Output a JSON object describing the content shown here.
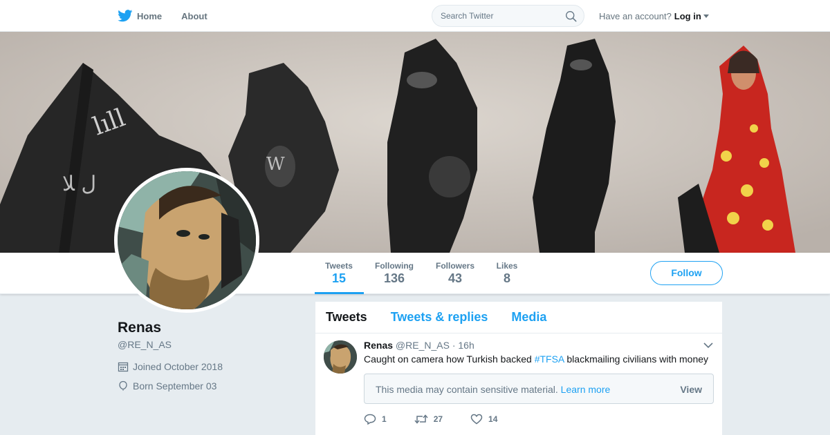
{
  "nav": {
    "home_label": "Home",
    "about_label": "About",
    "search_placeholder": "Search Twitter",
    "account_prompt": "Have an account?",
    "login_label": "Log in"
  },
  "stats": {
    "tweets_label": "Tweets",
    "tweets_value": "15",
    "following_label": "Following",
    "following_value": "136",
    "followers_label": "Followers",
    "followers_value": "43",
    "likes_label": "Likes",
    "likes_value": "8"
  },
  "follow_label": "Follow",
  "profile": {
    "name": "Renas",
    "handle": "@RE_N_AS",
    "joined": "Joined October 2018",
    "born": "Born September 03"
  },
  "timeline": {
    "tabs": [
      "Tweets",
      "Tweets & replies",
      "Media"
    ],
    "tweet": {
      "name": "Renas",
      "handle": "@RE_N_AS",
      "time": "· 16h",
      "text_before": "Caught on camera how Turkish backed",
      "hashtag": "#TFSA",
      "text_after": "blackmailing civilians with money",
      "media_notice": "This media may contain sensitive material.",
      "media_link": "Learn more",
      "media_view": "View",
      "replies": "1",
      "retweets": "27",
      "likes": "14"
    }
  },
  "colors": {
    "accent": "#1da1f2",
    "muted": "#657786",
    "background": "#e6ecf0"
  },
  "icons": [
    "twitter-bird-icon",
    "search-icon",
    "caret-down-icon",
    "calendar-icon",
    "balloon-icon",
    "chevron-down-icon",
    "reply-icon",
    "retweet-icon",
    "heart-icon"
  ]
}
